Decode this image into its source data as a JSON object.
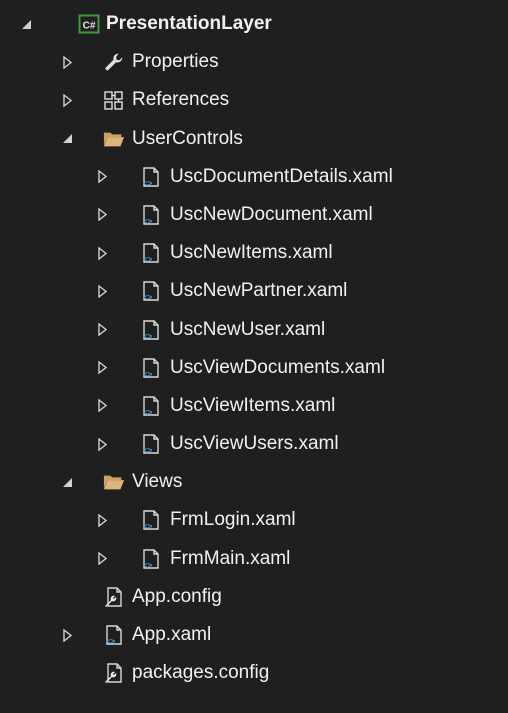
{
  "tree": [
    {
      "id": "root",
      "label": "PresentationLayer",
      "depth": 0,
      "state": "expanded",
      "icon": "csharp-project-icon",
      "bold": true
    },
    {
      "id": "properties",
      "label": "Properties",
      "depth": 1,
      "state": "collapsed",
      "icon": "wrench-icon"
    },
    {
      "id": "references",
      "label": "References",
      "depth": 1,
      "state": "collapsed",
      "icon": "references-icon"
    },
    {
      "id": "usercontrols",
      "label": "UserControls",
      "depth": 1,
      "state": "expanded",
      "icon": "folder-open-icon"
    },
    {
      "id": "uscdocumentdetails",
      "label": "UscDocumentDetails.xaml",
      "depth": 2,
      "state": "collapsed",
      "icon": "xaml-file-icon"
    },
    {
      "id": "uscnewdocument",
      "label": "UscNewDocument.xaml",
      "depth": 2,
      "state": "collapsed",
      "icon": "xaml-file-icon"
    },
    {
      "id": "uscnewitems",
      "label": "UscNewItems.xaml",
      "depth": 2,
      "state": "collapsed",
      "icon": "xaml-file-icon"
    },
    {
      "id": "uscnewpartner",
      "label": "UscNewPartner.xaml",
      "depth": 2,
      "state": "collapsed",
      "icon": "xaml-file-icon"
    },
    {
      "id": "uscnewuser",
      "label": "UscNewUser.xaml",
      "depth": 2,
      "state": "collapsed",
      "icon": "xaml-file-icon"
    },
    {
      "id": "uscviewdocuments",
      "label": "UscViewDocuments.xaml",
      "depth": 2,
      "state": "collapsed",
      "icon": "xaml-file-icon"
    },
    {
      "id": "uscviewitems",
      "label": "UscViewItems.xaml",
      "depth": 2,
      "state": "collapsed",
      "icon": "xaml-file-icon"
    },
    {
      "id": "uscviewusers",
      "label": "UscViewUsers.xaml",
      "depth": 2,
      "state": "collapsed",
      "icon": "xaml-file-icon"
    },
    {
      "id": "views",
      "label": "Views",
      "depth": 1,
      "state": "expanded",
      "icon": "folder-open-icon"
    },
    {
      "id": "frmlogin",
      "label": "FrmLogin.xaml",
      "depth": 2,
      "state": "collapsed",
      "icon": "xaml-file-icon"
    },
    {
      "id": "frmmain",
      "label": "FrmMain.xaml",
      "depth": 2,
      "state": "collapsed",
      "icon": "xaml-file-icon"
    },
    {
      "id": "appconfig",
      "label": "App.config",
      "depth": 1,
      "state": "none",
      "icon": "config-file-icon"
    },
    {
      "id": "appxaml",
      "label": "App.xaml",
      "depth": 1,
      "state": "collapsed",
      "icon": "xaml-file-icon"
    },
    {
      "id": "packagesconfig",
      "label": "packages.config",
      "depth": 1,
      "state": "none",
      "icon": "config-file-icon"
    }
  ],
  "colors": {
    "background": "#1f1f1f",
    "text": "#f1f1f1",
    "arrow": "#d0d0d0",
    "folder": "#dcb67a",
    "csharp_green": "#3c9a3c",
    "xaml_blue": "#4aa3df"
  }
}
